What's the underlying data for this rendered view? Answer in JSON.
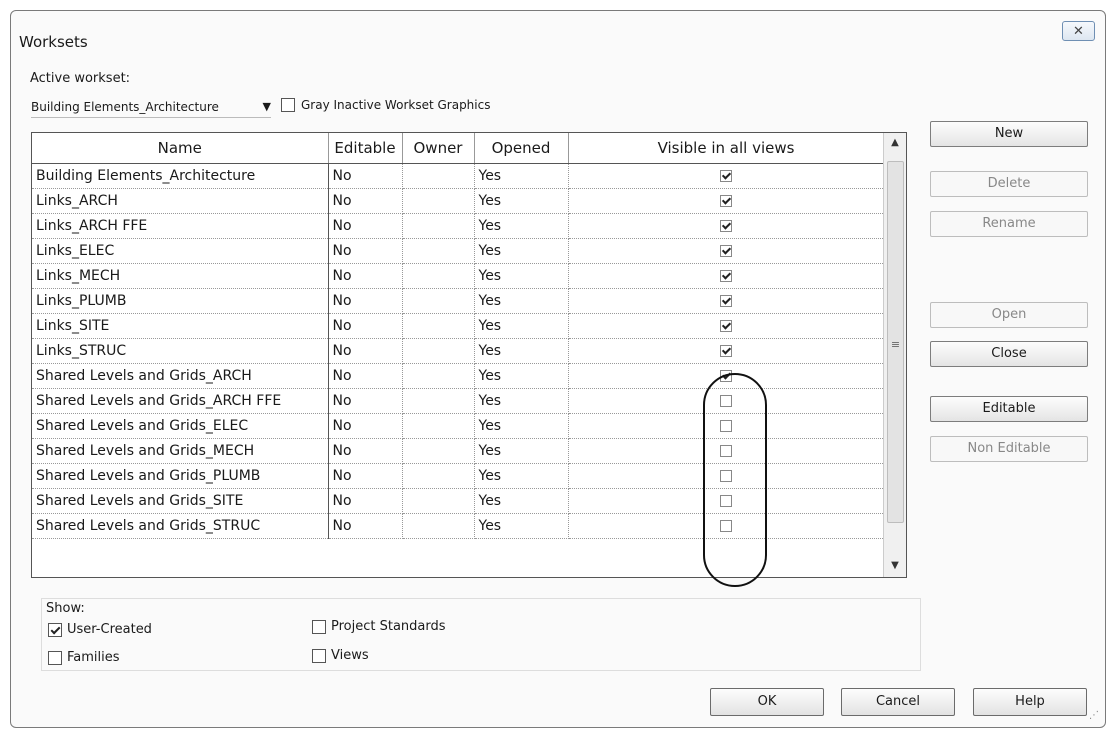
{
  "window": {
    "title": "Worksets",
    "close_label": "✕"
  },
  "active_workset": {
    "label": "Active workset:",
    "value": "Building Elements_Architecture",
    "gray_inactive_label": "Gray Inactive Workset Graphics",
    "gray_inactive_checked": false
  },
  "table": {
    "columns": [
      "Name",
      "Editable",
      "Owner",
      "Opened",
      "Visible in all views"
    ],
    "rows": [
      {
        "name": "Building Elements_Architecture",
        "editable": "No",
        "owner": "",
        "opened": "Yes",
        "visible": true
      },
      {
        "name": "Links_ARCH",
        "editable": "No",
        "owner": "",
        "opened": "Yes",
        "visible": true
      },
      {
        "name": "Links_ARCH FFE",
        "editable": "No",
        "owner": "",
        "opened": "Yes",
        "visible": true
      },
      {
        "name": "Links_ELEC",
        "editable": "No",
        "owner": "",
        "opened": "Yes",
        "visible": true
      },
      {
        "name": "Links_MECH",
        "editable": "No",
        "owner": "",
        "opened": "Yes",
        "visible": true
      },
      {
        "name": "Links_PLUMB",
        "editable": "No",
        "owner": "",
        "opened": "Yes",
        "visible": true
      },
      {
        "name": "Links_SITE",
        "editable": "No",
        "owner": "",
        "opened": "Yes",
        "visible": true
      },
      {
        "name": "Links_STRUC",
        "editable": "No",
        "owner": "",
        "opened": "Yes",
        "visible": true
      },
      {
        "name": "Shared Levels and Grids_ARCH",
        "editable": "No",
        "owner": "",
        "opened": "Yes",
        "visible": true
      },
      {
        "name": "Shared Levels and Grids_ARCH FFE",
        "editable": "No",
        "owner": "",
        "opened": "Yes",
        "visible": false
      },
      {
        "name": "Shared Levels and Grids_ELEC",
        "editable": "No",
        "owner": "",
        "opened": "Yes",
        "visible": false
      },
      {
        "name": "Shared Levels and Grids_MECH",
        "editable": "No",
        "owner": "",
        "opened": "Yes",
        "visible": false
      },
      {
        "name": "Shared Levels and Grids_PLUMB",
        "editable": "No",
        "owner": "",
        "opened": "Yes",
        "visible": false
      },
      {
        "name": "Shared Levels and Grids_SITE",
        "editable": "No",
        "owner": "",
        "opened": "Yes",
        "visible": false
      },
      {
        "name": "Shared Levels and Grids_STRUC",
        "editable": "No",
        "owner": "",
        "opened": "Yes",
        "visible": false
      }
    ]
  },
  "side_buttons": {
    "new": "New",
    "delete": "Delete",
    "rename": "Rename",
    "open": "Open",
    "close": "Close",
    "editable": "Editable",
    "non_editable": "Non Editable"
  },
  "show": {
    "label": "Show:",
    "user_created": {
      "label": "User-Created",
      "checked": true
    },
    "families": {
      "label": "Families",
      "checked": false
    },
    "project_standards": {
      "label": "Project Standards",
      "checked": false
    },
    "views": {
      "label": "Views",
      "checked": false
    }
  },
  "footer": {
    "ok": "OK",
    "cancel": "Cancel",
    "help": "Help"
  }
}
